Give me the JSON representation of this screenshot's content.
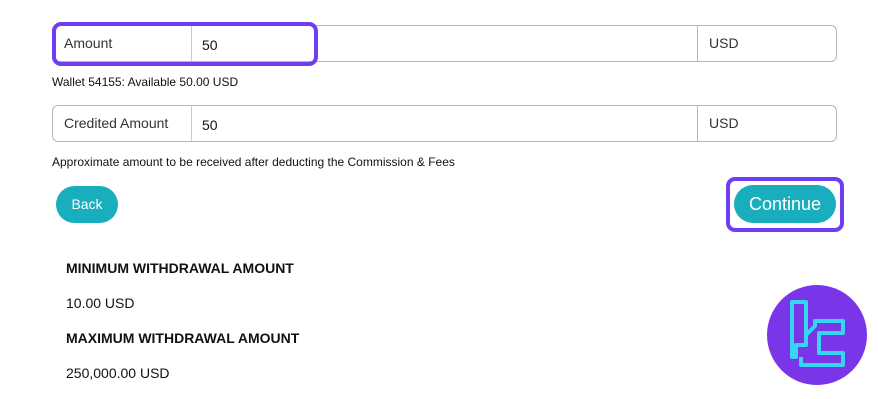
{
  "amount_row": {
    "label": "Amount",
    "value": "50",
    "currency": "USD"
  },
  "wallet_info": "Wallet 54155: Available 50.00 USD",
  "credited_row": {
    "label": "Credited Amount",
    "value": "50",
    "currency": "USD"
  },
  "credited_hint": "Approximate amount to be received after deducting the Commission & Fees",
  "buttons": {
    "back": "Back",
    "continue": "Continue"
  },
  "limits": {
    "min_title": "MINIMUM WITHDRAWAL AMOUNT",
    "min_value": "10.00 USD",
    "max_title": "MAXIMUM WITHDRAWAL AMOUNT",
    "max_value": "250,000.00 USD"
  },
  "colors": {
    "accent": "#19aebd",
    "highlight": "#6f3ef0",
    "logo_bg": "#7b35e8",
    "logo_fg": "#35d6f2"
  },
  "icons": {
    "watermark": "brand-logo-icon"
  }
}
